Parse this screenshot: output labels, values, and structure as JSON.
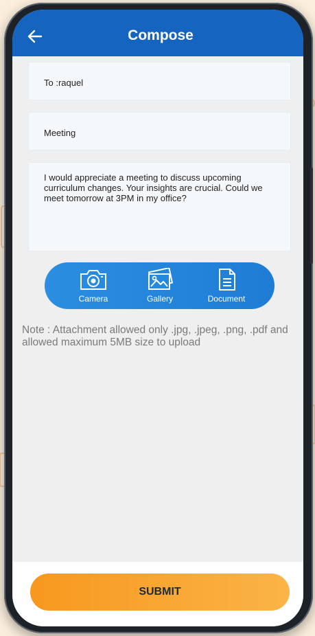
{
  "appbar": {
    "title": "Compose",
    "back_icon": "arrow-left-icon"
  },
  "form": {
    "to_value": "To :raquel",
    "subject_value": "Meeting",
    "message_value": "I would appreciate a meeting to discuss upcoming curriculum changes. Your insights are crucial. Could we meet tomorrow at 3PM in my office?"
  },
  "attachments": [
    {
      "label": "Camera",
      "icon": "camera-icon"
    },
    {
      "label": "Gallery",
      "icon": "gallery-icon"
    },
    {
      "label": "Document",
      "icon": "document-icon"
    }
  ],
  "note": "Note : Attachment allowed only .jpg, .jpeg, .png, .pdf and allowed maximum 5MB size to upload",
  "submit_label": "SUBMIT",
  "colors": {
    "appbar": "#1565c0",
    "attach_bar": "#2489dc",
    "submit": "#f7a531",
    "background": "#efefef"
  }
}
